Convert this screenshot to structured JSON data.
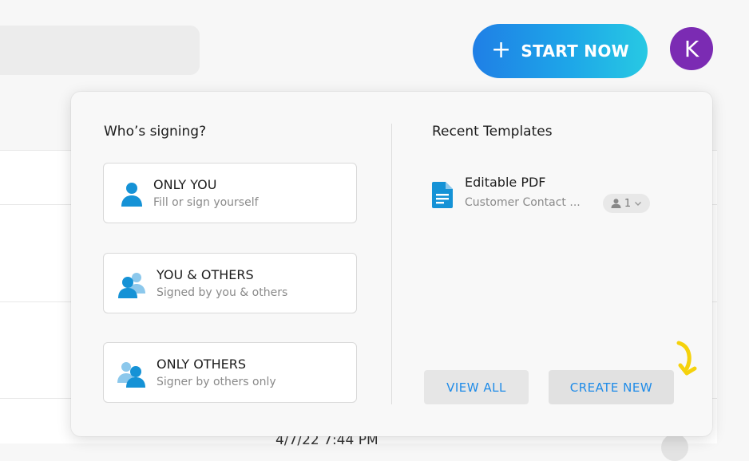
{
  "header": {
    "start_now_label": "START NOW",
    "avatar_initial": "K"
  },
  "background": {
    "row_text": "4/7/22 7:44 PM"
  },
  "panel": {
    "signing_title": "Who’s signing?",
    "options": [
      {
        "title": "ONLY YOU",
        "subtitle": "Fill or sign yourself",
        "icon": "single-person-icon"
      },
      {
        "title": "YOU & OTHERS",
        "subtitle": "Signed by you & others",
        "icon": "group-icon"
      },
      {
        "title": "ONLY OTHERS",
        "subtitle": "Signer by others only",
        "icon": "others-group-icon"
      }
    ],
    "templates_title": "Recent Templates",
    "templates": [
      {
        "name": "Editable PDF",
        "subtitle": "Customer Contact ...",
        "signers": "1",
        "icon": "document-icon"
      }
    ],
    "view_all_label": "VIEW ALL",
    "create_new_label": "CREATE NEW"
  },
  "colors": {
    "accent_blue": "#1e8be8",
    "gradient_start": "#1f7fe6",
    "gradient_end": "#27c9e3",
    "avatar_purple": "#7b2bb3",
    "icon_blue": "#1592d6",
    "hint_yellow": "#f5d20c"
  }
}
